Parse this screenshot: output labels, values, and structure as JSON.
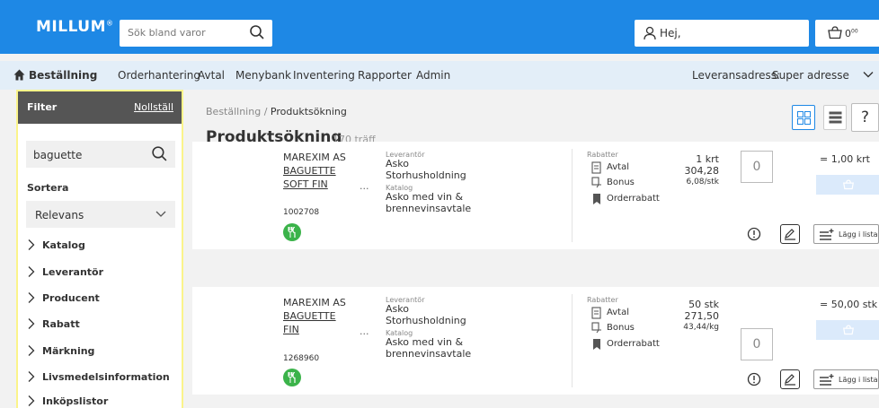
{
  "header": {
    "logo": "MILLUM",
    "logo_mark": "®",
    "search_placeholder": "Sök bland varor",
    "user_label": "Hej,",
    "cart_amount": "0",
    "cart_decimals": "00"
  },
  "nav": {
    "items": [
      "Beställning",
      "Orderhantering",
      "Avtal",
      "Menybank",
      "Inventering",
      "Rapporter",
      "Admin"
    ],
    "delivery_label": "Leveransadress:",
    "delivery_value": "Super adresse"
  },
  "sidebar": {
    "title": "Filter",
    "reset": "Nollställ",
    "search_value": "baguette",
    "sort_label": "Sortera",
    "sort_value": "Relevans",
    "facets": [
      "Katalog",
      "Leverantör",
      "Producent",
      "Rabatt",
      "Märkning",
      "Livsmedelsinformation",
      "Inköpslistor"
    ]
  },
  "main": {
    "breadcrumb_root": "Beställning",
    "breadcrumb_sep": "/",
    "breadcrumb_current": "Produktsökning",
    "title": "Produktsökning",
    "count": "170 träff",
    "help": "?"
  },
  "labels": {
    "supplier_label": "Leverantör",
    "catalog_label": "Katalog",
    "rebates_label": "Rabatter",
    "rebate_avtal": "Avtal",
    "rebate_bonus": "Bonus",
    "rebate_order": "Orderrabatt",
    "add_to_list": "Lägg i lista",
    "ellipsis": "..."
  },
  "colors": {
    "brand": "#1e88e5",
    "nav_bg": "#e3eef8",
    "eco_green": "#3bb34a",
    "filter_header": "#555555",
    "highlight": "#fbf48a"
  },
  "products": [
    {
      "producer": "MAREXIM AS",
      "name": "BAGUETTE SOFT FIN",
      "article": "1002708",
      "supplier": "Asko Storhusholdning",
      "catalog": "Asko med vin & brennevinsavtale",
      "unit_line": "1 krt",
      "price": "304,28",
      "unit_price": "6,08/stk",
      "quantity": "0",
      "sum": "= 1,00 krt"
    },
    {
      "producer": "MAREXIM AS",
      "name": "BAGUETTE FIN",
      "article": "1268960",
      "supplier": "Asko Storhusholdning",
      "catalog": "Asko med vin & brennevinsavtale",
      "unit_line": "50 stk",
      "price": "271,50",
      "unit_price": "43,44/kg",
      "quantity": "0",
      "sum": "= 50,00 stk"
    }
  ]
}
